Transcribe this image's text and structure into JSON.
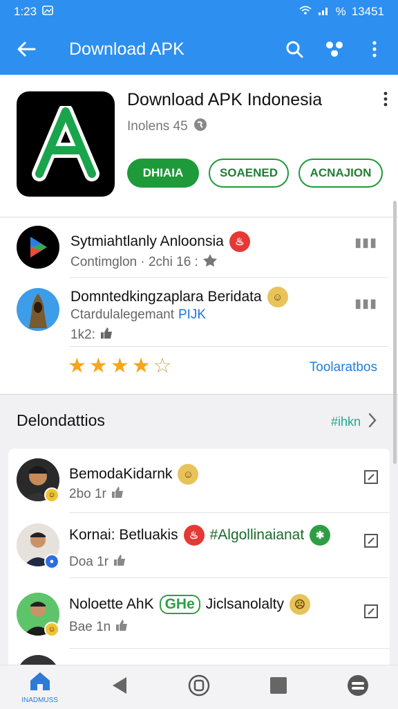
{
  "status_bar": {
    "time": "1:23",
    "battery_text": "13451",
    "signal_text": "%"
  },
  "app_bar": {
    "title": "Download APK",
    "color": "#2d8ff0",
    "icons": [
      "back-arrow-icon",
      "search-icon",
      "share-icon",
      "more-vertical-icon"
    ]
  },
  "app_header": {
    "title": "Download APK Indonesia",
    "subtitle": "Inolens 45",
    "buttons": [
      {
        "label": "DHIAIA"
      },
      {
        "label": "SOAENED"
      },
      {
        "label": "ACNAJION"
      }
    ],
    "accent": "#1f9a3a"
  },
  "reviews": [
    {
      "name": "Sytmiahtlanly Anloonsia",
      "meta": "Contimglon · 2chi 16 :",
      "extra": ""
    },
    {
      "name": "Domntedkingzaplara Beridata",
      "meta": "Ctardulalegemant",
      "link": "PIJK",
      "extra": "1k2:"
    }
  ],
  "rating": {
    "stars": 4,
    "max": 5,
    "link_label": "Toolaratbos"
  },
  "section": {
    "title": "Delondattios",
    "link_label": "#ihkn"
  },
  "comments": [
    {
      "name": "BemodaKidarnk",
      "meta": "2bo 1r"
    },
    {
      "name": "Kornai: Betluakis",
      "hashtag": "#Algollinaianat",
      "meta": "Doa 1r"
    },
    {
      "name": "Noloette AhK",
      "tag": "GHe",
      "suffix": "Jiclsanolalty",
      "meta": "Bae 1n"
    }
  ],
  "bottom_nav": {
    "home_label": "INADMUSS",
    "items": [
      "home-icon",
      "back-triangle-icon",
      "recents-icon",
      "stop-icon",
      "profile-icon"
    ]
  }
}
